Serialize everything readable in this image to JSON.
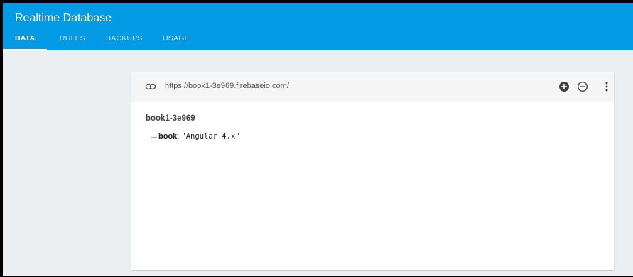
{
  "app": {
    "title": "Realtime Database"
  },
  "tabs": [
    {
      "label": "DATA",
      "active": true
    },
    {
      "label": "RULES",
      "active": false
    },
    {
      "label": "BACKUPS",
      "active": false
    },
    {
      "label": "USAGE",
      "active": false
    }
  ],
  "colors": {
    "header": "#039be5",
    "background": "#eceff1"
  },
  "database": {
    "url": "https://book1-3e969.firebaseio.com/",
    "root_key": "book1-3e969",
    "children": [
      {
        "key": "book",
        "separator": ": ",
        "value": "\"Angular 4.x\""
      }
    ]
  },
  "toolbar_icons": [
    "link-icon",
    "add-icon",
    "remove-icon",
    "more-vert-icon"
  ]
}
